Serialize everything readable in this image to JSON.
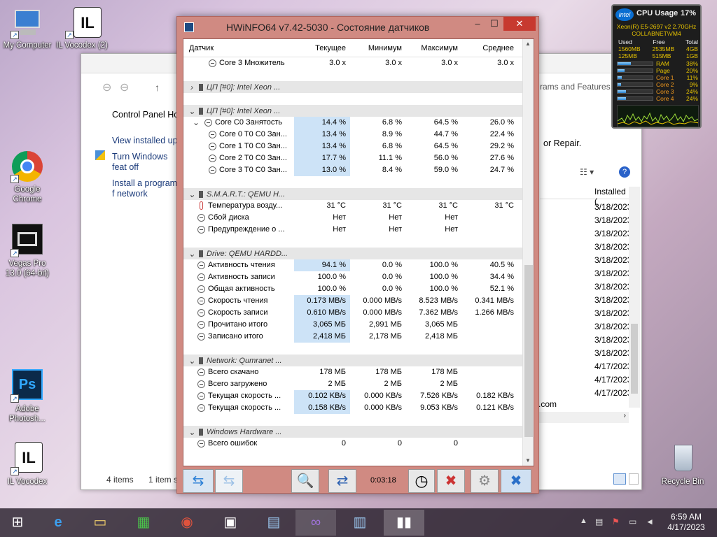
{
  "desktop": {
    "icons": [
      {
        "label": "My Computer",
        "name": "my-computer-icon"
      },
      {
        "label": "IL Vocodex (2)",
        "name": "il-vocodex-icon"
      },
      {
        "label": "Google Chrome",
        "name": "chrome-icon"
      },
      {
        "label": "Vegas Pro 13.0 (64-bit)",
        "name": "vegas-icon"
      },
      {
        "label": "Adobe Photosh...",
        "name": "photoshop-icon"
      },
      {
        "label": "IL Vocodex",
        "name": "il-vocodex-icon"
      },
      {
        "label": "Recycle Bin",
        "name": "recycle-bin-icon"
      }
    ]
  },
  "explorer": {
    "items": [
      "Control Panel Ho",
      "View installed upd",
      "Turn Windows feat off",
      "Install a program f network"
    ],
    "programs_features": "rams and Features",
    "repair": "or Repair.",
    "installed_header": "Installed (",
    "dates": [
      "3/18/2023",
      "3/18/2023",
      "3/18/2023",
      "3/18/2023",
      "3/18/2023",
      "3/18/2023",
      "3/18/2023",
      "3/18/2023",
      "3/18/2023",
      "3/18/2023",
      "3/18/2023",
      "3/18/2023",
      "4/17/2023",
      "4/17/2023",
      "4/17/2023"
    ],
    "com_text": ".com",
    "status_items": "4 items",
    "status_selected": "1 item s"
  },
  "hwinfo": {
    "title": "HWiNFO64 v7.42-5030 - Состояние датчиков",
    "columns": [
      "Датчик",
      "Текущее",
      "Минимум",
      "Максимум",
      "Среднее"
    ],
    "rows": [
      {
        "t": "row",
        "icon": "sensor",
        "label": "Core 3 Множитель",
        "v": [
          "3.0 x",
          "3.0 x",
          "3.0 x",
          "3.0 x"
        ],
        "indent": 1
      },
      {
        "t": "spacer"
      },
      {
        "t": "group",
        "label": "ЦП [#0]: Intel Xeon ...",
        "arrow": ">"
      },
      {
        "t": "spacer"
      },
      {
        "t": "group",
        "label": "ЦП [#0]: Intel Xeon ...",
        "arrow": "v"
      },
      {
        "t": "row",
        "icon": "sensor",
        "label": "Core C0 Занятость",
        "v": [
          "14.4 %",
          "6.8 %",
          "64.5 %",
          "26.0 %"
        ],
        "hl": true,
        "sub": "v"
      },
      {
        "t": "row",
        "icon": "sensor",
        "label": "Core 0 T0 C0 Зан...",
        "v": [
          "13.4 %",
          "8.9 %",
          "44.7 %",
          "22.4 %"
        ],
        "hl": true,
        "indent": 1
      },
      {
        "t": "row",
        "icon": "sensor",
        "label": "Core 1 T0 C0 Зан...",
        "v": [
          "13.4 %",
          "6.8 %",
          "64.5 %",
          "29.2 %"
        ],
        "hl": true,
        "indent": 1
      },
      {
        "t": "row",
        "icon": "sensor",
        "label": "Core 2 T0 C0 Зан...",
        "v": [
          "17.7 %",
          "11.1 %",
          "56.0 %",
          "27.6 %"
        ],
        "hl": true,
        "indent": 1
      },
      {
        "t": "row",
        "icon": "sensor",
        "label": "Core 3 T0 C0 Зан...",
        "v": [
          "13.0 %",
          "8.4 %",
          "59.0 %",
          "24.7 %"
        ],
        "hl": true,
        "indent": 1
      },
      {
        "t": "spacer"
      },
      {
        "t": "group",
        "label": "S.M.A.R.T.: QEMU H...",
        "arrow": "v"
      },
      {
        "t": "row",
        "icon": "thermo",
        "label": "Температура возду...",
        "v": [
          "31 °C",
          "31 °C",
          "31 °C",
          "31 °C"
        ]
      },
      {
        "t": "row",
        "icon": "sensor",
        "label": "Сбой диска",
        "v": [
          "Нет",
          "Нет",
          "Нет",
          ""
        ]
      },
      {
        "t": "row",
        "icon": "sensor",
        "label": "Предупреждение о ...",
        "v": [
          "Нет",
          "Нет",
          "Нет",
          ""
        ]
      },
      {
        "t": "spacer"
      },
      {
        "t": "group",
        "label": "Drive: QEMU HARDD...",
        "arrow": "v"
      },
      {
        "t": "row",
        "icon": "sensor",
        "label": "Активность чтения",
        "v": [
          "94.1 %",
          "0.0 %",
          "100.0 %",
          "40.5 %"
        ],
        "hl": true
      },
      {
        "t": "row",
        "icon": "sensor",
        "label": "Активность записи",
        "v": [
          "100.0 %",
          "0.0 %",
          "100.0 %",
          "34.4 %"
        ]
      },
      {
        "t": "row",
        "icon": "sensor",
        "label": "Общая активность",
        "v": [
          "100.0 %",
          "0.0 %",
          "100.0 %",
          "52.1 %"
        ]
      },
      {
        "t": "row",
        "icon": "sensor",
        "label": "Скорость чтения",
        "v": [
          "0.173 MB/s",
          "0.000 MB/s",
          "8.523 MB/s",
          "0.341 MB/s"
        ],
        "hl": true
      },
      {
        "t": "row",
        "icon": "sensor",
        "label": "Скорость записи",
        "v": [
          "0.610 MB/s",
          "0.000 MB/s",
          "7.362 MB/s",
          "1.266 MB/s"
        ],
        "hl": true
      },
      {
        "t": "row",
        "icon": "sensor",
        "label": "Прочитано итого",
        "v": [
          "3,065 МБ",
          "2,991 МБ",
          "3,065 МБ",
          ""
        ],
        "hl": true
      },
      {
        "t": "row",
        "icon": "sensor",
        "label": "Записано итого",
        "v": [
          "2,418 МБ",
          "2,178 МБ",
          "2,418 МБ",
          ""
        ],
        "hl": true
      },
      {
        "t": "spacer"
      },
      {
        "t": "group",
        "label": "Network: Qumranet ...",
        "arrow": "v"
      },
      {
        "t": "row",
        "icon": "sensor",
        "label": "Всего скачано",
        "v": [
          "178 МБ",
          "178 МБ",
          "178 МБ",
          ""
        ]
      },
      {
        "t": "row",
        "icon": "sensor",
        "label": "Всего загружено",
        "v": [
          "2 МБ",
          "2 МБ",
          "2 МБ",
          ""
        ]
      },
      {
        "t": "row",
        "icon": "sensor",
        "label": "Текущая скорость ...",
        "v": [
          "0.102 KB/s",
          "0.000 KB/s",
          "7.526 KB/s",
          "0.182 KB/s"
        ],
        "hl": true
      },
      {
        "t": "row",
        "icon": "sensor",
        "label": "Текущая скорость ...",
        "v": [
          "0.158 KB/s",
          "0.000 KB/s",
          "9.053 KB/s",
          "0.121 KB/s"
        ],
        "hl": true
      },
      {
        "t": "spacer"
      },
      {
        "t": "group",
        "label": "Windows Hardware ...",
        "arrow": "v"
      },
      {
        "t": "row",
        "icon": "sensor",
        "label": "Всего ошибок",
        "v": [
          "0",
          "0",
          "0",
          ""
        ]
      }
    ],
    "timer": "0:03:18"
  },
  "gadget": {
    "brand": "intel",
    "title": "CPU Usage",
    "percent": "17%",
    "cpu_name": "Xeon(R) E5-2697 v2 2.70GHz",
    "host": "COLLABNET\\VM4",
    "mem_headers": [
      "Used",
      "Free",
      "Total"
    ],
    "mem_rows": [
      [
        "1560MB",
        "2535MB",
        "4GB"
      ],
      [
        "125MB",
        "515MB",
        "1GB"
      ]
    ],
    "bars": [
      {
        "label": "RAM",
        "value": "38%",
        "fill": 0.38
      },
      {
        "label": "Page",
        "value": "20%",
        "fill": 0.2
      },
      {
        "label": "Core 1",
        "value": "11%",
        "fill": 0.11
      },
      {
        "label": "Core 2",
        "value": "9%",
        "fill": 0.09
      },
      {
        "label": "Core 3",
        "value": "24%",
        "fill": 0.24
      },
      {
        "label": "Core 4",
        "value": "24%",
        "fill": 0.24
      }
    ]
  },
  "taskbar": {
    "time": "6:59 AM",
    "date": "4/17/2023"
  }
}
